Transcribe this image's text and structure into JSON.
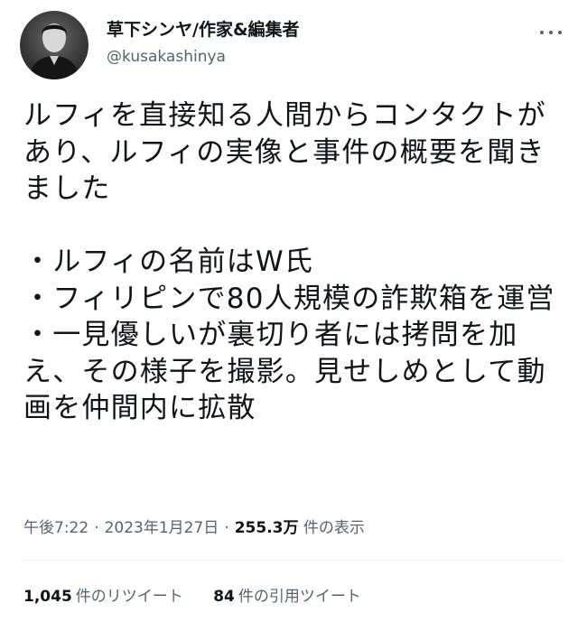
{
  "user": {
    "display_name": "草下シンヤ/作家&編集者",
    "handle": "@kusakashinya"
  },
  "more_icon": "more-horizontal-icon",
  "tweet": {
    "text": "ルフィを直接知る人間からコンタクトがあり、ルフィの実像と事件の概要を聞きました\n\n・ルフィの名前はW氏\n・フィリピンで80人規模の詐欺箱を運営\n・一見優しいが裏切り者には拷問を加え、その様子を撮影。見せしめとして動画を仲間内に拡散"
  },
  "meta": {
    "time": "午後7:22",
    "separator": "·",
    "date": "2023年1月27日",
    "views_count": "255.3万",
    "views_label": "件の表示"
  },
  "stats": {
    "retweets_count": "1,045",
    "retweets_label": "件のリツイート",
    "quotes_count": "84",
    "quotes_label": "件の引用ツイート"
  },
  "colors": {
    "text": "#0f1419",
    "secondary": "#536471",
    "divider": "#eff3f4"
  }
}
